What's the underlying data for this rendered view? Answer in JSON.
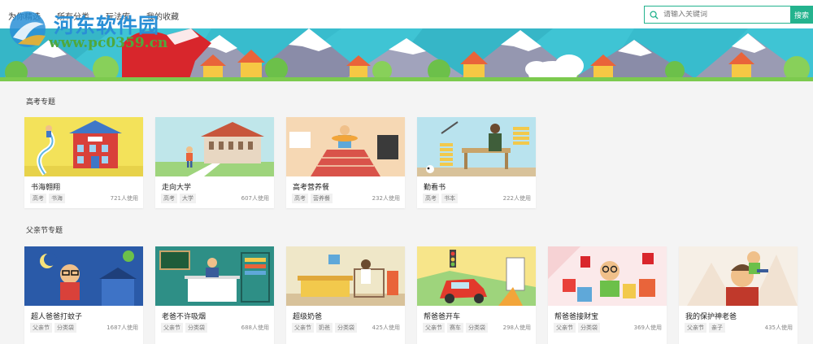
{
  "nav": {
    "items": [
      "为你精选",
      "所有分类",
      "玩法库",
      "我的收藏"
    ],
    "active_index": 0
  },
  "watermark": {
    "title": "河东软件园",
    "url": "www.pc0359.cn"
  },
  "search": {
    "placeholder": "请输入关键词",
    "button_label": "搜索"
  },
  "sections": [
    {
      "title": "高考专题",
      "cards": [
        {
          "title": "书海翱翔",
          "tags": [
            "高考",
            "书海"
          ],
          "uses": "721人使用",
          "thumb": "library-scene"
        },
        {
          "title": "走向大学",
          "tags": [
            "高考",
            "大学"
          ],
          "uses": "607人使用",
          "thumb": "university-scene"
        },
        {
          "title": "高考营养餐",
          "tags": [
            "高考",
            "营养餐"
          ],
          "uses": "232人使用",
          "thumb": "meal-scene"
        },
        {
          "title": "勤看书",
          "tags": [
            "高考",
            "书本"
          ],
          "uses": "222人使用",
          "thumb": "study-scene"
        }
      ]
    },
    {
      "title": "父亲节专题",
      "cards": [
        {
          "title": "超人爸爸打蚊子",
          "tags": [
            "父亲节",
            "分类袋"
          ],
          "uses": "1687人使用",
          "thumb": "night-scene"
        },
        {
          "title": "老爸不许吸烟",
          "tags": [
            "父亲节",
            "分类袋"
          ],
          "uses": "688人使用",
          "thumb": "office-scene"
        },
        {
          "title": "超级奶爸",
          "tags": [
            "父亲节",
            "奶爸",
            "分类袋"
          ],
          "uses": "425人使用",
          "thumb": "room-scene"
        },
        {
          "title": "帮爸爸开车",
          "tags": [
            "父亲节",
            "赛车",
            "分类袋"
          ],
          "uses": "298人使用",
          "thumb": "car-scene"
        },
        {
          "title": "帮爸爸接财宝",
          "tags": [
            "父亲节",
            "分类袋"
          ],
          "uses": "369人使用",
          "thumb": "gift-scene"
        },
        {
          "title": "我的保护神老爸",
          "tags": [
            "父亲节",
            "亲子"
          ],
          "uses": "435人使用",
          "thumb": "shoulder-scene"
        }
      ]
    }
  ],
  "colors": {
    "accent": "#24b38e",
    "background": "#f4f4f4"
  }
}
